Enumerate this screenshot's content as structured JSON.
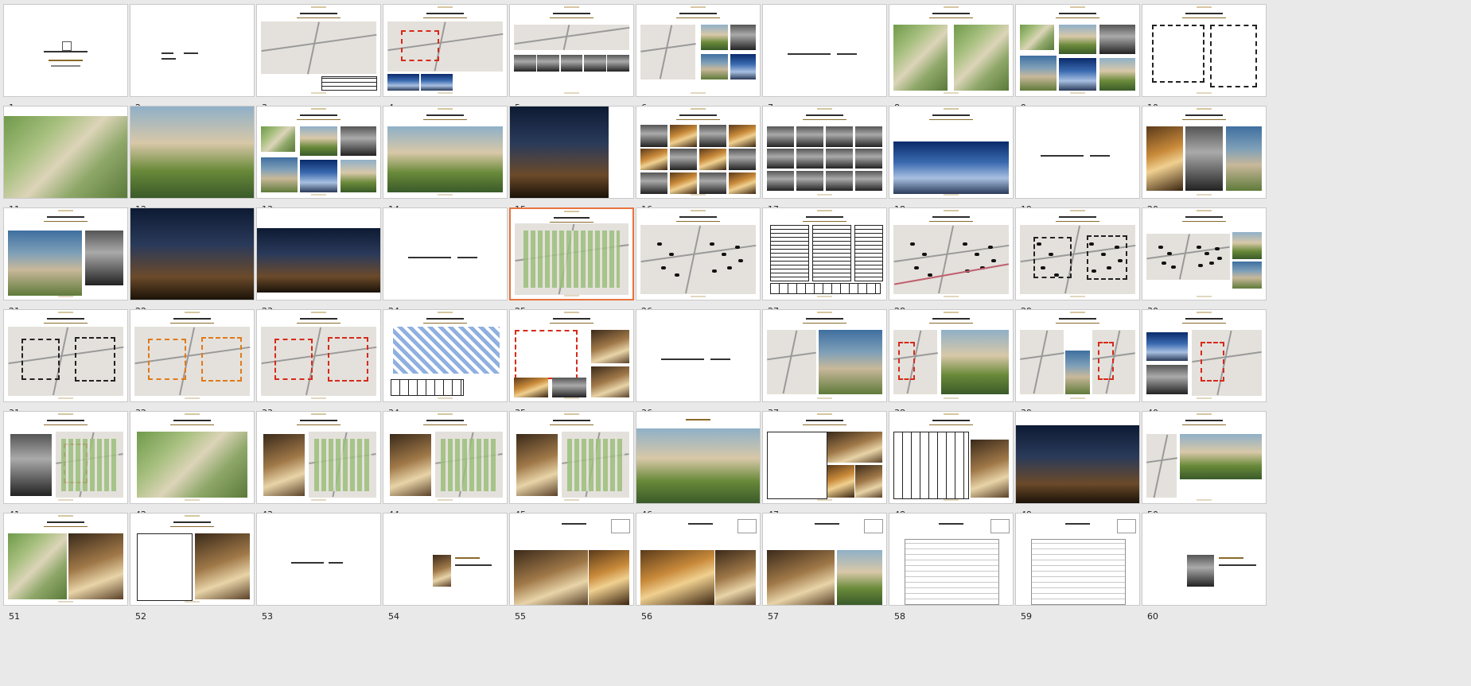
{
  "view": "slide-sorter",
  "selected_slide": "25",
  "slides": [
    {
      "number": "1",
      "layout": "cover",
      "star": false,
      "selected": false
    },
    {
      "number": "2",
      "layout": "divider-left",
      "star": false,
      "selected": false
    },
    {
      "number": "3",
      "layout": "map-table",
      "star": false,
      "selected": false
    },
    {
      "number": "4",
      "layout": "map-photos",
      "star": false,
      "selected": false
    },
    {
      "number": "5",
      "layout": "map-strip",
      "star": false,
      "selected": false
    },
    {
      "number": "6",
      "layout": "map-photo-grid",
      "star": false,
      "selected": false
    },
    {
      "number": "7",
      "layout": "divider",
      "star": false,
      "selected": false
    },
    {
      "number": "8",
      "layout": "two-plans",
      "star": false,
      "selected": false
    },
    {
      "number": "9",
      "layout": "photo-grid",
      "star": false,
      "selected": false
    },
    {
      "number": "10",
      "layout": "outline-plan",
      "star": false,
      "selected": false
    },
    {
      "number": "11",
      "layout": "full-aerial",
      "star": false,
      "selected": false
    },
    {
      "number": "12",
      "layout": "full-render",
      "star": false,
      "selected": false
    },
    {
      "number": "13",
      "layout": "photo-grid",
      "star": false,
      "selected": false
    },
    {
      "number": "14",
      "layout": "render-wide",
      "star": false,
      "selected": false
    },
    {
      "number": "15",
      "layout": "render-tall",
      "star": false,
      "selected": false
    },
    {
      "number": "16",
      "layout": "collage",
      "star": false,
      "selected": false
    },
    {
      "number": "17",
      "layout": "collage-bw",
      "star": false,
      "selected": false
    },
    {
      "number": "18",
      "layout": "towers",
      "star": false,
      "selected": false
    },
    {
      "number": "19",
      "layout": "divider",
      "star": false,
      "selected": false
    },
    {
      "number": "20",
      "layout": "photos-3",
      "star": false,
      "selected": false
    },
    {
      "number": "21",
      "layout": "building-2",
      "star": false,
      "selected": false
    },
    {
      "number": "22",
      "layout": "full-night",
      "star": false,
      "selected": false
    },
    {
      "number": "23",
      "layout": "interior-dark",
      "star": false,
      "selected": false
    },
    {
      "number": "24",
      "layout": "divider",
      "star": false,
      "selected": false
    },
    {
      "number": "25",
      "layout": "site-plan",
      "star": false,
      "selected": true
    },
    {
      "number": "26",
      "layout": "site-markers",
      "star": false,
      "selected": false
    },
    {
      "number": "27",
      "layout": "tables",
      "star": false,
      "selected": false
    },
    {
      "number": "28",
      "layout": "site-markers-lines",
      "star": false,
      "selected": false
    },
    {
      "number": "29",
      "layout": "site-markers-dashed",
      "star": false,
      "selected": false
    },
    {
      "number": "30",
      "layout": "site-side-photos",
      "star": false,
      "selected": false
    },
    {
      "number": "31",
      "layout": "site-outline",
      "star": false,
      "selected": false
    },
    {
      "number": "32",
      "layout": "site-orange",
      "star": false,
      "selected": false
    },
    {
      "number": "33",
      "layout": "site-red",
      "star": false,
      "selected": false
    },
    {
      "number": "34",
      "layout": "blue-plan",
      "star": false,
      "selected": false
    },
    {
      "number": "35",
      "layout": "red-plan-photos",
      "star": false,
      "selected": false
    },
    {
      "number": "36",
      "layout": "divider",
      "star": false,
      "selected": false
    },
    {
      "number": "37",
      "layout": "plan-photo",
      "star": false,
      "selected": false
    },
    {
      "number": "38",
      "layout": "plan-red-render",
      "star": false,
      "selected": false
    },
    {
      "number": "39",
      "layout": "plan-detail",
      "star": true,
      "selected": false
    },
    {
      "number": "40",
      "layout": "photos-plan",
      "star": true,
      "selected": false
    },
    {
      "number": "41",
      "layout": "photo-plan-red",
      "star": true,
      "selected": false
    },
    {
      "number": "42",
      "layout": "plan-green",
      "star": true,
      "selected": false
    },
    {
      "number": "43",
      "layout": "photo-plan",
      "star": true,
      "selected": false
    },
    {
      "number": "44",
      "layout": "photo-plan",
      "star": true,
      "selected": false
    },
    {
      "number": "45",
      "layout": "photo-plan",
      "star": true,
      "selected": false
    },
    {
      "number": "46",
      "layout": "full-pool",
      "star": false,
      "selected": false
    },
    {
      "number": "47",
      "layout": "plan-interiors",
      "star": false,
      "selected": false
    },
    {
      "number": "48",
      "layout": "plan-table-photos",
      "star": false,
      "selected": false
    },
    {
      "number": "49",
      "layout": "full-night-house",
      "star": false,
      "selected": false
    },
    {
      "number": "50",
      "layout": "photo-render",
      "star": false,
      "selected": false
    },
    {
      "number": "51",
      "layout": "plan-interiors-b",
      "star": false,
      "selected": false
    },
    {
      "number": "52",
      "layout": "plan-b-interiors",
      "star": false,
      "selected": false
    },
    {
      "number": "53",
      "layout": "divider-c",
      "star": false,
      "selected": false
    },
    {
      "number": "54",
      "layout": "small-photo",
      "star": false,
      "selected": false
    },
    {
      "number": "55",
      "layout": "interior-rooms",
      "star": false,
      "selected": false
    },
    {
      "number": "56",
      "layout": "bedroom",
      "star": false,
      "selected": false
    },
    {
      "number": "57",
      "layout": "bathroom",
      "star": false,
      "selected": false
    },
    {
      "number": "58",
      "layout": "floorplan",
      "star": false,
      "selected": false
    },
    {
      "number": "59",
      "layout": "floorplan",
      "star": false,
      "selected": false
    },
    {
      "number": "60",
      "layout": "car-photo",
      "star": false,
      "selected": false
    }
  ],
  "icons": {
    "star": "animation-star-icon"
  },
  "colors": {
    "selected_border": "#e8733d",
    "background": "#e9e9e9"
  }
}
